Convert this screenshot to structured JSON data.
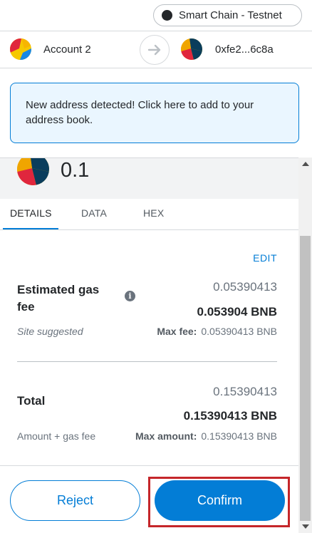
{
  "network": {
    "label": "Smart Chain - Testnet"
  },
  "sender": {
    "name": "Account 2"
  },
  "recipient": {
    "address": "0xfe2...6c8a"
  },
  "banner": {
    "text": "New address detected! Click here to add to your address book."
  },
  "amount": {
    "value": "0.1"
  },
  "tabs": [
    {
      "label": "DETAILS",
      "active": true
    },
    {
      "label": "DATA",
      "active": false
    },
    {
      "label": "HEX",
      "active": false
    }
  ],
  "details": {
    "edit_label": "EDIT",
    "gas": {
      "label": "Estimated gas fee",
      "sub_label": "Site suggested",
      "value_secondary": "0.05390413",
      "value_primary": "0.053904 BNB",
      "max_label": "Max fee:",
      "max_value": "0.05390413 BNB"
    },
    "total": {
      "label": "Total",
      "sub_label": "Amount + gas fee",
      "value_secondary": "0.15390413",
      "value_primary": "0.15390413 BNB",
      "max_label": "Max amount:",
      "max_value": "0.15390413 BNB"
    }
  },
  "footer": {
    "reject_label": "Reject",
    "confirm_label": "Confirm"
  },
  "colors": {
    "primary": "#037dd6",
    "banner_bg": "#eaf6ff",
    "highlight": "#c5262a"
  },
  "icons": [
    "network-dot-icon",
    "account-identicon",
    "arrow-right-icon",
    "recipient-identicon",
    "token-identicon",
    "info-icon"
  ]
}
